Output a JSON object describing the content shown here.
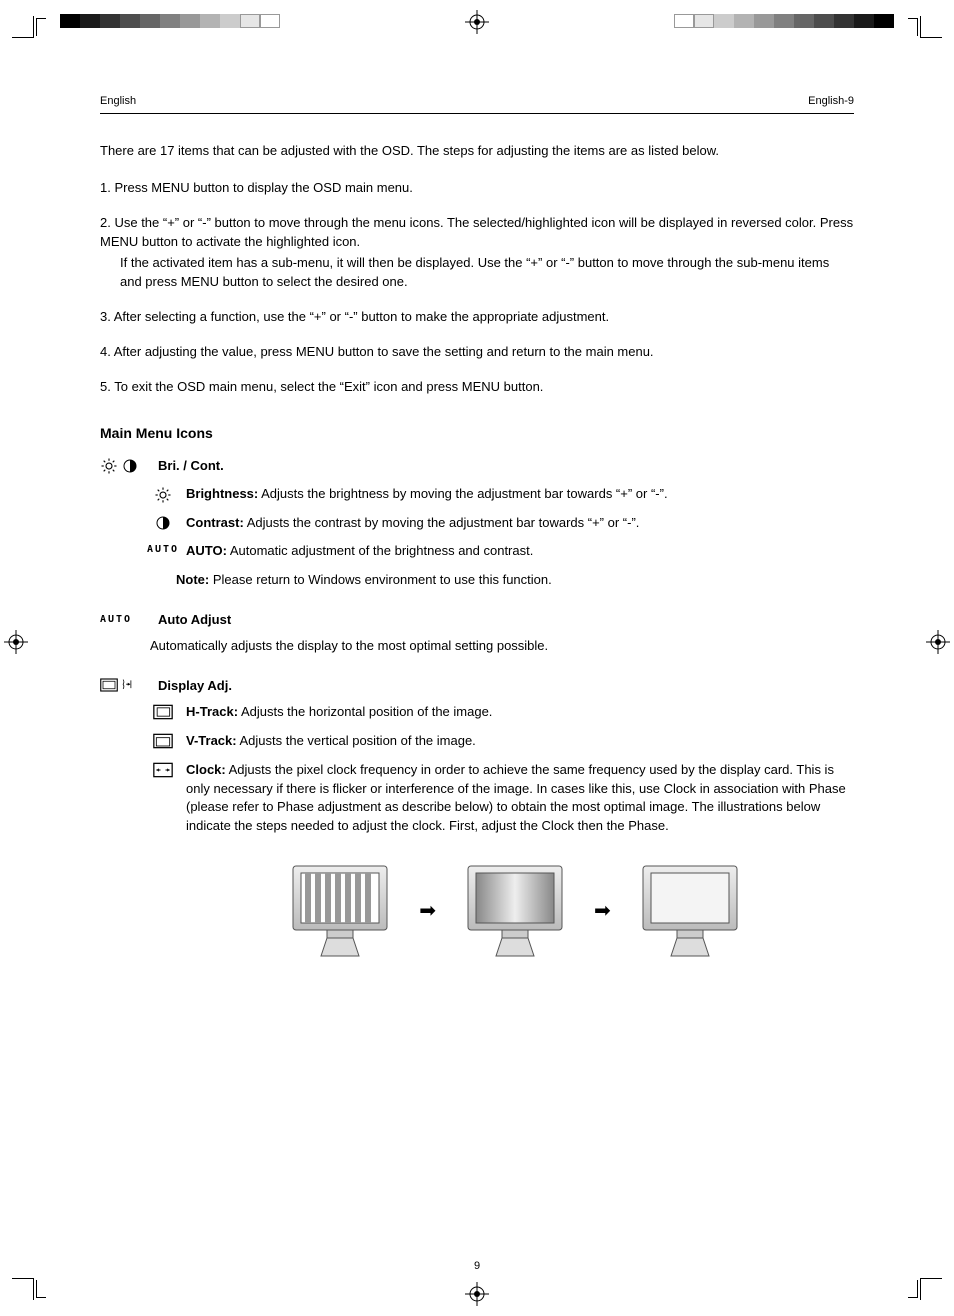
{
  "header": {
    "left": "English",
    "right": "English-9"
  },
  "intro": "There are 17 items that can be adjusted with the OSD. The steps for adjusting the items are as listed below.",
  "steps": [
    {
      "n": "1.",
      "text": "Press MENU button to display the OSD main menu."
    },
    {
      "n": "2.",
      "text": "Use the “+” or “-” button to move through the menu icons. The selected/highlighted icon will be displayed in reversed color. Press MENU button to activate the highlighted icon.",
      "sub": "If the activated item has a sub-menu, it will then be displayed. Use the “+” or “-” button to move through the sub-menu items and press MENU button to select the desired one."
    },
    {
      "n": "3.",
      "text": "After selecting a function, use the “+” or “-” button to make the appropriate adjustment."
    },
    {
      "n": "4.",
      "text": "After adjusting the value, press MENU button to save the setting and return to the main menu."
    },
    {
      "n": "5.",
      "text": "To exit the OSD main menu, select the “Exit” icon and press MENU button."
    }
  ],
  "section_title": "Main Menu Icons",
  "menu_bc": {
    "title": "Bri. / Cont.",
    "brightness": {
      "label": "Brightness:",
      "desc": "Adjusts the brightness by moving the adjustment bar towards “+” or “-”."
    },
    "contrast": {
      "label": "Contrast:",
      "desc": "Adjusts the contrast by moving the adjustment bar towards “+” or “-”."
    },
    "auto": {
      "label": "AUTO:",
      "desc": "Automatic adjustment of the brightness and contrast.",
      "note_label": "Note:",
      "note": "Please return to Windows environment to use this function."
    }
  },
  "menu_auto": {
    "title": "Auto Adjust",
    "desc": "Automatically adjusts the display to the most optimal setting possible."
  },
  "menu_disp": {
    "title": "Display Adj.",
    "htrack": {
      "label": "H-Track:",
      "desc": "Adjusts the horizontal position of the image."
    },
    "vtrack": {
      "label": "V-Track:",
      "desc": "Adjusts the vertical position of the image."
    },
    "clock": {
      "label": "Clock:",
      "desc": "Adjusts the pixel clock frequency in order to achieve the same frequency used by the display card. This is only necessary if there is flicker or interference of the image. In cases like this, use Clock in association with Phase (please refer to Phase adjustment as describe below) to obtain the most optimal image. The illustrations below indicate the steps needed to adjust the clock. First, adjust the Clock then the Phase."
    }
  },
  "page_number": "9",
  "grayscale": [
    "#000000",
    "#1a1a1a",
    "#333333",
    "#4d4d4d",
    "#666666",
    "#808080",
    "#999999",
    "#b3b3b3",
    "#cccccc",
    "#e6e6e6",
    "#ffffff"
  ],
  "grayscale_rev": [
    "#ffffff",
    "#e6e6e6",
    "#cccccc",
    "#b3b3b3",
    "#999999",
    "#808080",
    "#666666",
    "#4d4d4d",
    "#333333",
    "#1a1a1a",
    "#000000"
  ]
}
